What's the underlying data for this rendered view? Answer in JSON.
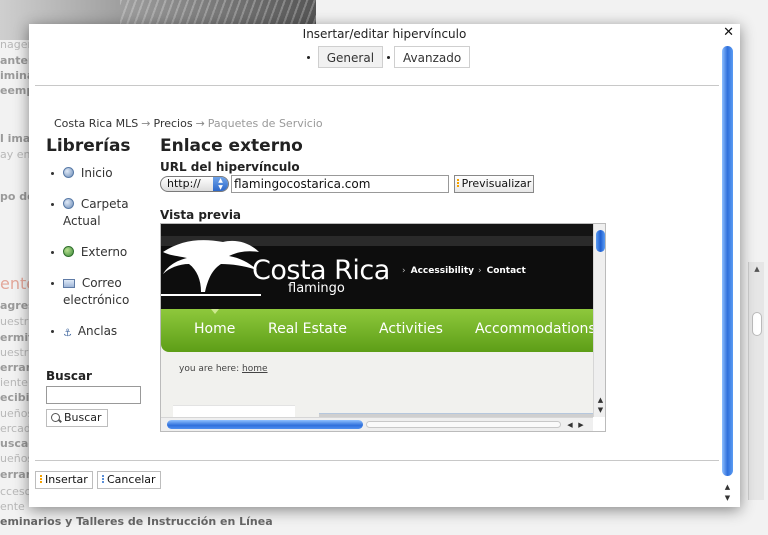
{
  "background": {
    "lines": [
      "nagen",
      "anter",
      "imina",
      "eemp",
      "l ima",
      "ay en",
      "po de",
      "ente",
      "agres",
      "uestr",
      "ermit",
      "uestr",
      "errar",
      "iente",
      "ecibi",
      "ueños",
      "ercad",
      "uscad",
      "ueños",
      "errar",
      "cceso",
      "ente",
      "eminarios y Talleres de Instrucción en Línea"
    ]
  },
  "dialog": {
    "title": "Insertar/editar hipervínculo",
    "close_label": "✕",
    "tabs": [
      "General",
      "Avanzado"
    ],
    "breadcrumb": [
      "Costa Rica MLS",
      "Precios",
      "Paquetes de Servicio"
    ],
    "breadcrumb_separator": "→",
    "libraries": {
      "title": "Librerías",
      "items": [
        "Inicio",
        "Carpeta Actual",
        "Externo",
        "Correo electrónico",
        "Anclas"
      ],
      "icons": [
        "circle-icon",
        "folder-icon",
        "globe-icon",
        "mail-icon",
        "anchor-icon"
      ]
    },
    "search": {
      "label": "Buscar",
      "value": "",
      "button": "Buscar"
    },
    "external": {
      "title": "Enlace externo",
      "url_label": "URL del hipervínculo",
      "protocol": "http://",
      "url_value": "flamingocostarica.com",
      "preview_button": "Previsualizar",
      "preview_label": "Vista previa"
    },
    "preview_site": {
      "logo_main": "Costa Rica",
      "logo_sub": "flamingo",
      "top_links": [
        "Accessibility",
        "Contact"
      ],
      "nav": [
        "Home",
        "Real Estate",
        "Activities",
        "Accommodations"
      ],
      "here_prefix": "you are here:",
      "here_link": "home"
    },
    "footer": {
      "insert": "Insertar",
      "cancel": "Cancelar"
    }
  },
  "colors": {
    "nav_green": "#6aa81f",
    "scroll_blue": "#2f6fdb",
    "header_black": "#0d0d0d"
  }
}
